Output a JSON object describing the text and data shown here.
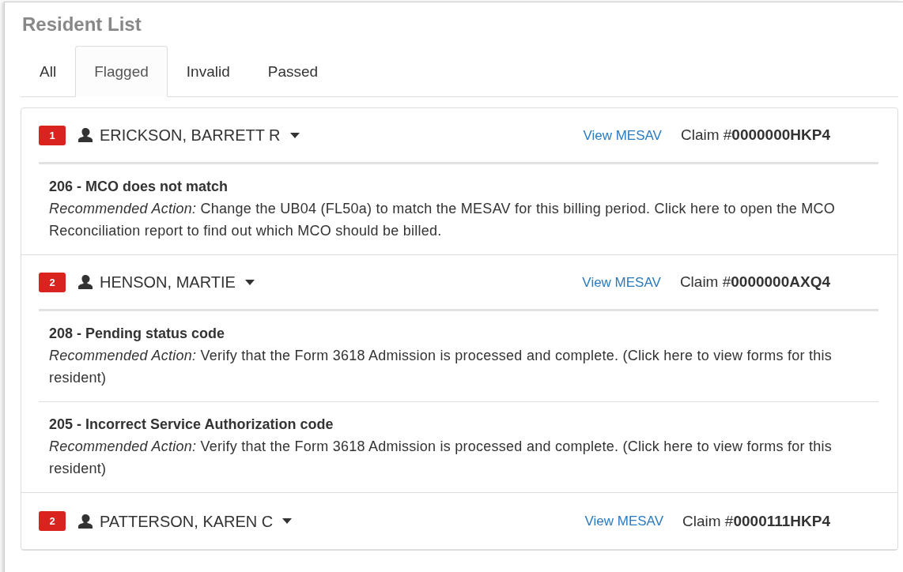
{
  "title": "Resident List",
  "tabs": [
    {
      "label": "All",
      "selected": false
    },
    {
      "label": "Flagged",
      "selected": true
    },
    {
      "label": "Invalid",
      "selected": false
    },
    {
      "label": "Passed",
      "selected": false
    }
  ],
  "residents": [
    {
      "count": "1",
      "name": "ERICKSON, BARRETT R",
      "link": "View MESAV",
      "claim": "Claim #**0000000HKP4**",
      "issues": [
        {
          "title": "206 - MCO does not match",
          "action": "*Recommended Action:* Change the UB04 (FL50a) to match the MESAV for this billing period. Click here to open the MCO Reconciliation report to find out which MCO should be billed."
        }
      ]
    },
    {
      "count": "2",
      "name": "HENSON, MARTIE",
      "link": "View MESAV",
      "claim": "Claim #**0000000AXQ4**",
      "issues": [
        {
          "title": "208 - Pending status code",
          "action": "*Recommended Action:* Verify that the Form 3618 Admission is processed and complete. (Click here to view forms for this resident)"
        },
        {
          "title": "205 - Incorrect Service Authorization code",
          "action": "*Recommended Action:* Verify that the Form 3618 Admission is processed and complete. (Click here to view forms for this resident)"
        }
      ]
    },
    {
      "count": "2",
      "name": "PATTERSON, KAREN C",
      "link": "View MESAV",
      "claim": "Claim #**0000111HKP4**"
    }
  ]
}
